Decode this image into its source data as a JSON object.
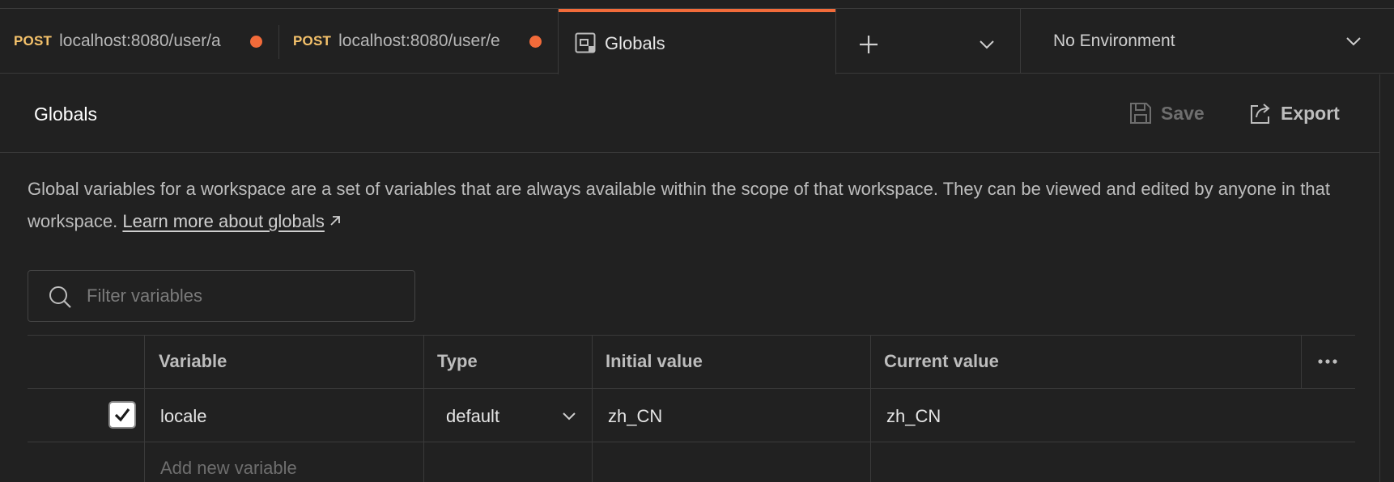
{
  "tabs": [
    {
      "method": "POST",
      "url": "localhost:8080/user/a",
      "unsaved": true
    },
    {
      "method": "POST",
      "url": "localhost:8080/user/e",
      "unsaved": true
    },
    {
      "title": "Globals",
      "icon": "globals-icon",
      "active": true
    }
  ],
  "tabbar": {
    "new_tab_icon": "plus-icon",
    "tabs_menu_icon": "chevron-down-icon"
  },
  "environment": {
    "label": "No Environment",
    "icon": "chevron-down-icon"
  },
  "header": {
    "title": "Globals",
    "save_label": "Save",
    "save_icon": "save-icon",
    "save_enabled": false,
    "export_label": "Export",
    "export_icon": "export-icon"
  },
  "description": {
    "text": "Global variables for a workspace are a set of variables that are always available within the scope of that workspace. They can be viewed and edited by anyone in that workspace.",
    "link_text": "Learn more about globals",
    "link_icon": "external-link-arrow-icon"
  },
  "search": {
    "placeholder": "Filter variables",
    "value": "",
    "icon": "search-icon"
  },
  "table": {
    "columns": [
      "Variable",
      "Type",
      "Initial value",
      "Current value"
    ],
    "more_icon": "more-horizontal-icon",
    "rows": [
      {
        "enabled": true,
        "variable": "locale",
        "type": "default",
        "initial_value": "zh_CN",
        "current_value": "zh_CN"
      }
    ],
    "add_placeholder": "Add new variable"
  },
  "colors": {
    "background": "#212121",
    "border": "#3a3a3a",
    "accent": "#f26b3a",
    "method": "#f5c26b"
  }
}
